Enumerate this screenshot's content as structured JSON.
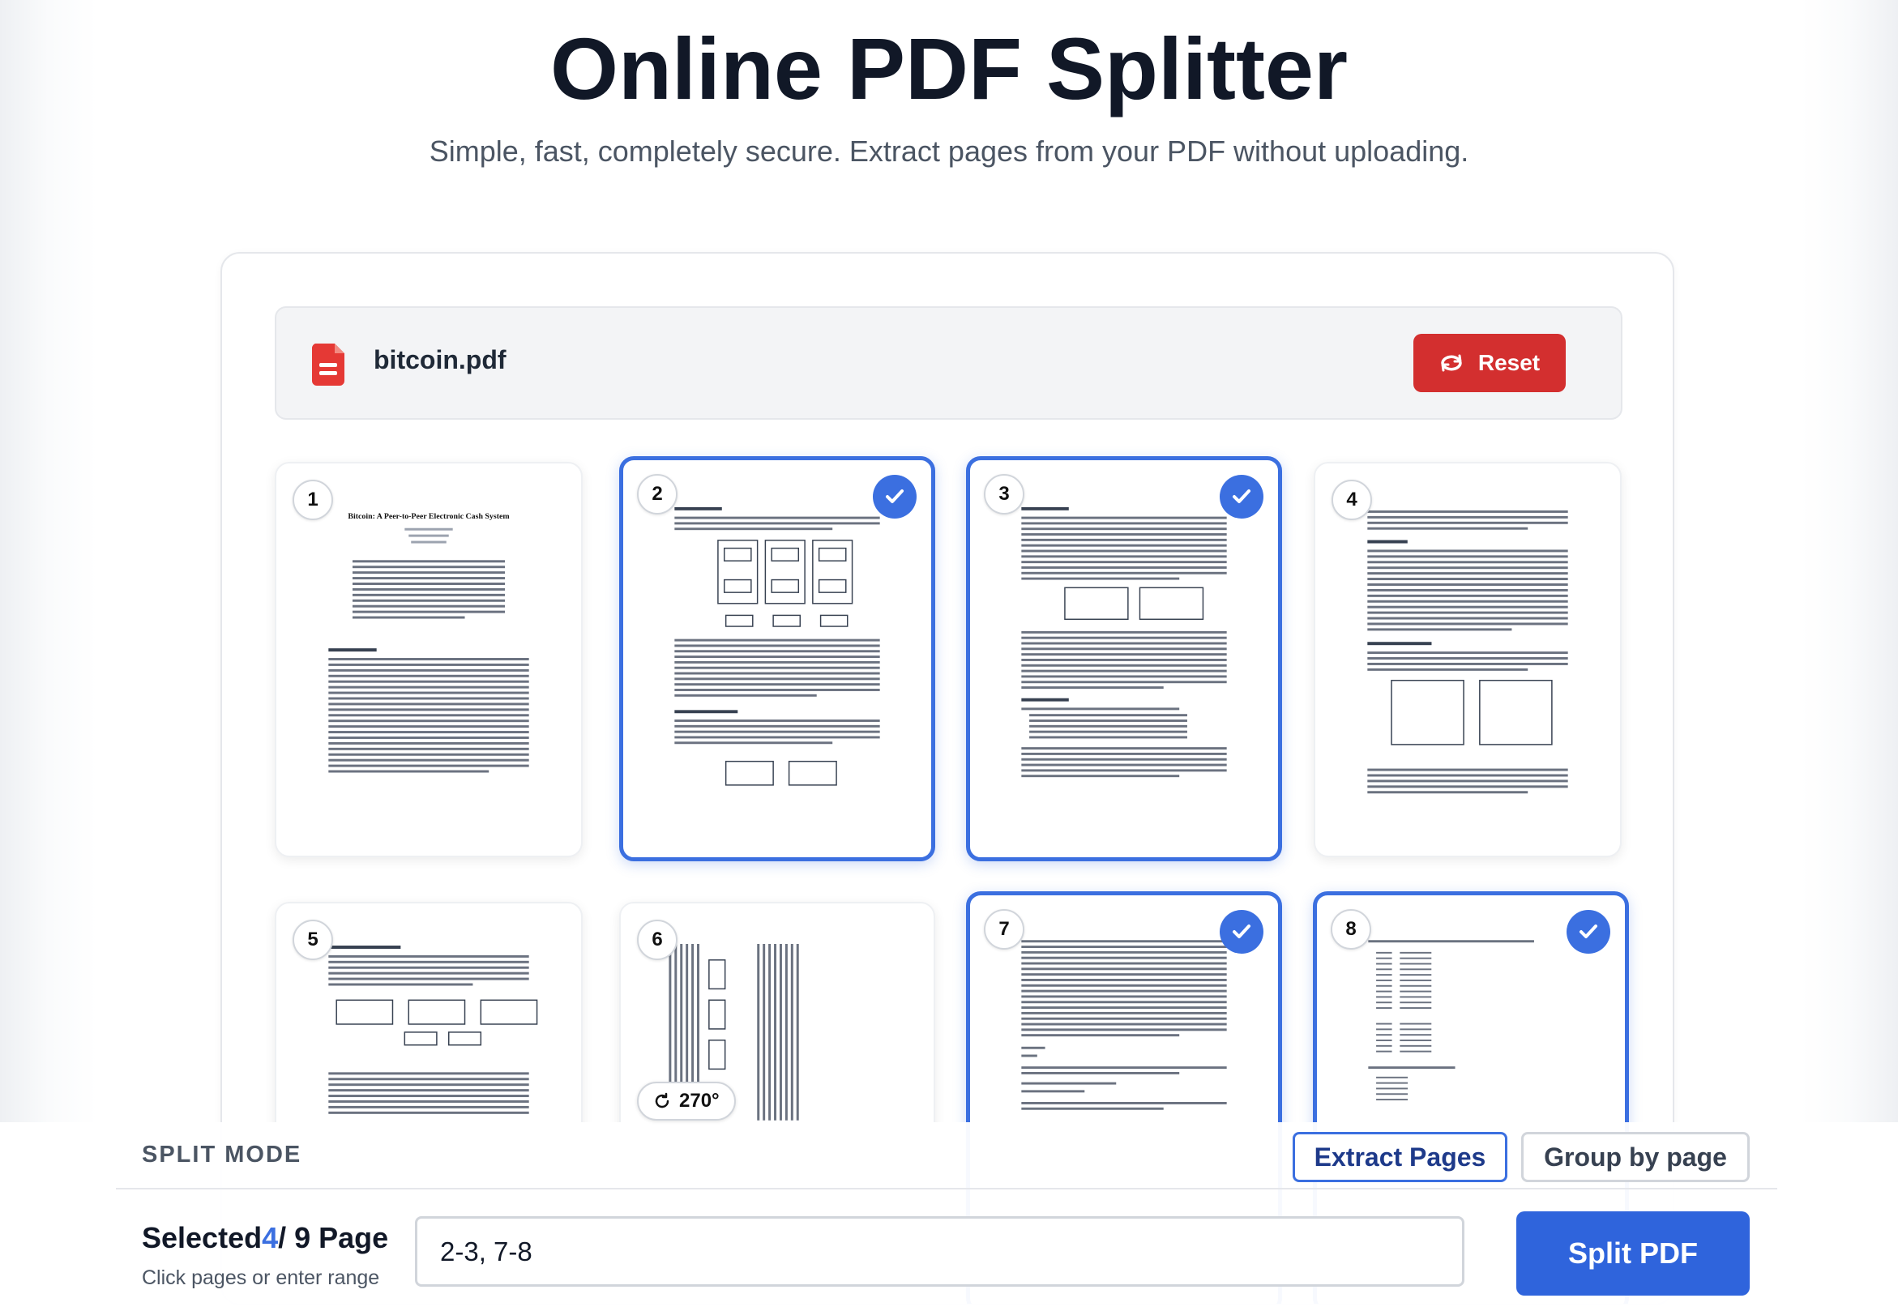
{
  "header": {
    "title": "Online PDF Splitter",
    "subtitle": "Simple, fast, completely secure. Extract pages from your PDF without uploading."
  },
  "file": {
    "name": "bitcoin.pdf",
    "icon": "pdf-file-icon",
    "reset_label": "Reset",
    "reset_icon": "reset-icon"
  },
  "pages": [
    {
      "number": "1",
      "selected": false,
      "doc_title": "Bitcoin: A Peer-to-Peer Electronic Cash System"
    },
    {
      "number": "2",
      "selected": true
    },
    {
      "number": "3",
      "selected": true
    },
    {
      "number": "4",
      "selected": false
    },
    {
      "number": "5",
      "selected": false
    },
    {
      "number": "6",
      "selected": false,
      "rotation_label": "270°"
    },
    {
      "number": "7",
      "selected": true
    },
    {
      "number": "8",
      "selected": true
    }
  ],
  "split_mode": {
    "label": "SPLIT MODE",
    "options": [
      "Extract Pages",
      "Group by page"
    ],
    "active": "Extract Pages"
  },
  "selection": {
    "prefix": "Selected",
    "count": "4",
    "suffix": "/ 9 Page",
    "hint": "Click pages or enter range",
    "range_value": "2-3, 7-8"
  },
  "actions": {
    "split_label": "Split PDF"
  },
  "colors": {
    "accent": "#3b6fe0",
    "danger": "#d32f2f"
  }
}
